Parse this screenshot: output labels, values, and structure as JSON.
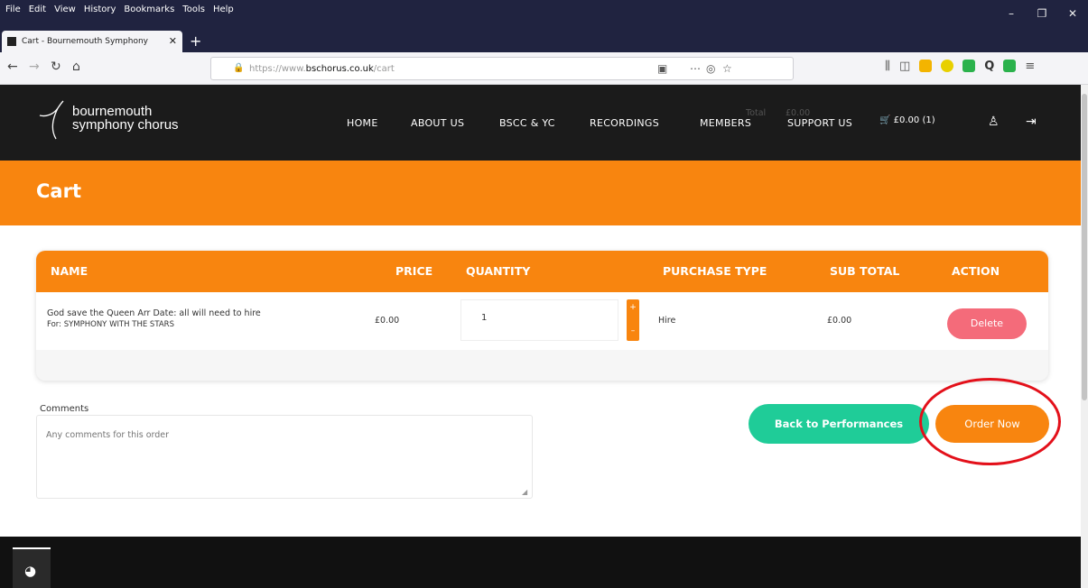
{
  "browser": {
    "menu": [
      "File",
      "Edit",
      "View",
      "History",
      "Bookmarks",
      "Tools",
      "Help"
    ],
    "tab_title": "Cart - Bournemouth Symphony",
    "url_prefix": "https://www.",
    "url_domain": "bschorus.co.uk",
    "url_path": "/cart"
  },
  "site": {
    "logo_line1": "bournemouth",
    "logo_line2": "symphony chorus",
    "nav": [
      "HOME",
      "ABOUT US",
      "BSCC & YC",
      "RECORDINGS",
      "MEMBERS",
      "SUPPORT US"
    ],
    "cart_summary": "£0.00 (1)"
  },
  "page": {
    "title": "Cart"
  },
  "table": {
    "headers": [
      "NAME",
      "PRICE",
      "QUANTITY",
      "PURCHASE TYPE",
      "SUB TOTAL",
      "ACTION"
    ],
    "row": {
      "name_line1": "God save the Queen Arr Date: all will need to hire",
      "name_line2": "For: SYMPHONY WITH THE STARS",
      "price": "£0.00",
      "quantity": "1",
      "purchase_type": "Hire",
      "sub_total": "£0.00",
      "action": "Delete"
    },
    "total_label": "Total",
    "total_value": "£0.00"
  },
  "comments": {
    "label": "Comments",
    "placeholder": "Any comments for this order"
  },
  "buttons": {
    "back": "Back to Performances",
    "order": "Order Now"
  },
  "colors": {
    "brand_orange": "#f8850f",
    "teal": "#1fcc98",
    "delete_pink": "#f46b7a",
    "highlight_red": "#e3101a"
  }
}
